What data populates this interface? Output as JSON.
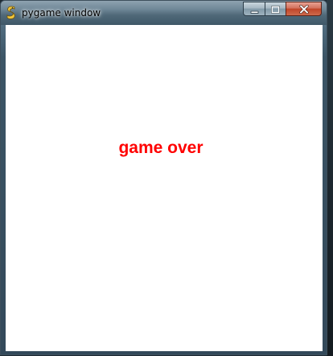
{
  "window": {
    "title": "pygame window",
    "icon": "pygame-snake-icon"
  },
  "controls": {
    "minimize_icon": "minimize-icon",
    "maximize_icon": "maximize-icon",
    "close_icon": "close-icon"
  },
  "game": {
    "message": "game over",
    "message_color": "#ff0000",
    "background_color": "#ffffff"
  }
}
